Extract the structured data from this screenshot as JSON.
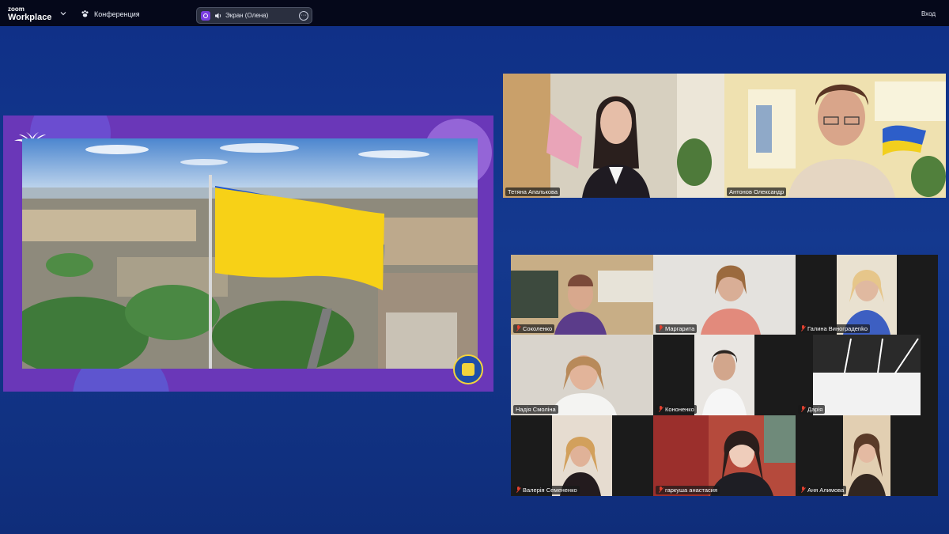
{
  "app": {
    "logo_line1": "zoom",
    "logo_line2": "Workplace",
    "meeting_type": "Конференция",
    "screen_share_label": "Экран (Олена)",
    "more_glyph": "···",
    "login_label": "Вход"
  },
  "colors": {
    "topbar": "#05081a",
    "background": "#14398f",
    "share_frame": "#6a37b8",
    "speaker_outline": "#27d49a",
    "mic_muted": "#e0402f",
    "flag_blue": "#2457c9",
    "flag_yellow": "#f7d117"
  },
  "icons": {
    "dropdown": "chevron-down-icon",
    "meeting": "paw-icon",
    "recording": "record-icon",
    "audio": "speaker-icon",
    "more": "more-icon",
    "muted": "mic-muted-icon"
  },
  "speaker_tiles": [
    {
      "name": "Тетяна Апалькова",
      "muted": false,
      "active_speaker": true
    },
    {
      "name": "Антонов Олександр",
      "muted": false,
      "active_speaker": false
    }
  ],
  "gallery_tiles": [
    {
      "name": "Соколенко",
      "muted": true
    },
    {
      "name": "Маргарита",
      "muted": true
    },
    {
      "name": "Галина Виноградenko",
      "muted": true
    },
    {
      "name": "Надія Смоліна",
      "muted": false
    },
    {
      "name": "Кононенко",
      "muted": true
    },
    {
      "name": "Дарія",
      "muted": true
    },
    {
      "name": "Валерія Семененко",
      "muted": true
    },
    {
      "name": "гаркуша анастасия",
      "muted": true
    },
    {
      "name": "Аня Алимова",
      "muted": true
    }
  ]
}
